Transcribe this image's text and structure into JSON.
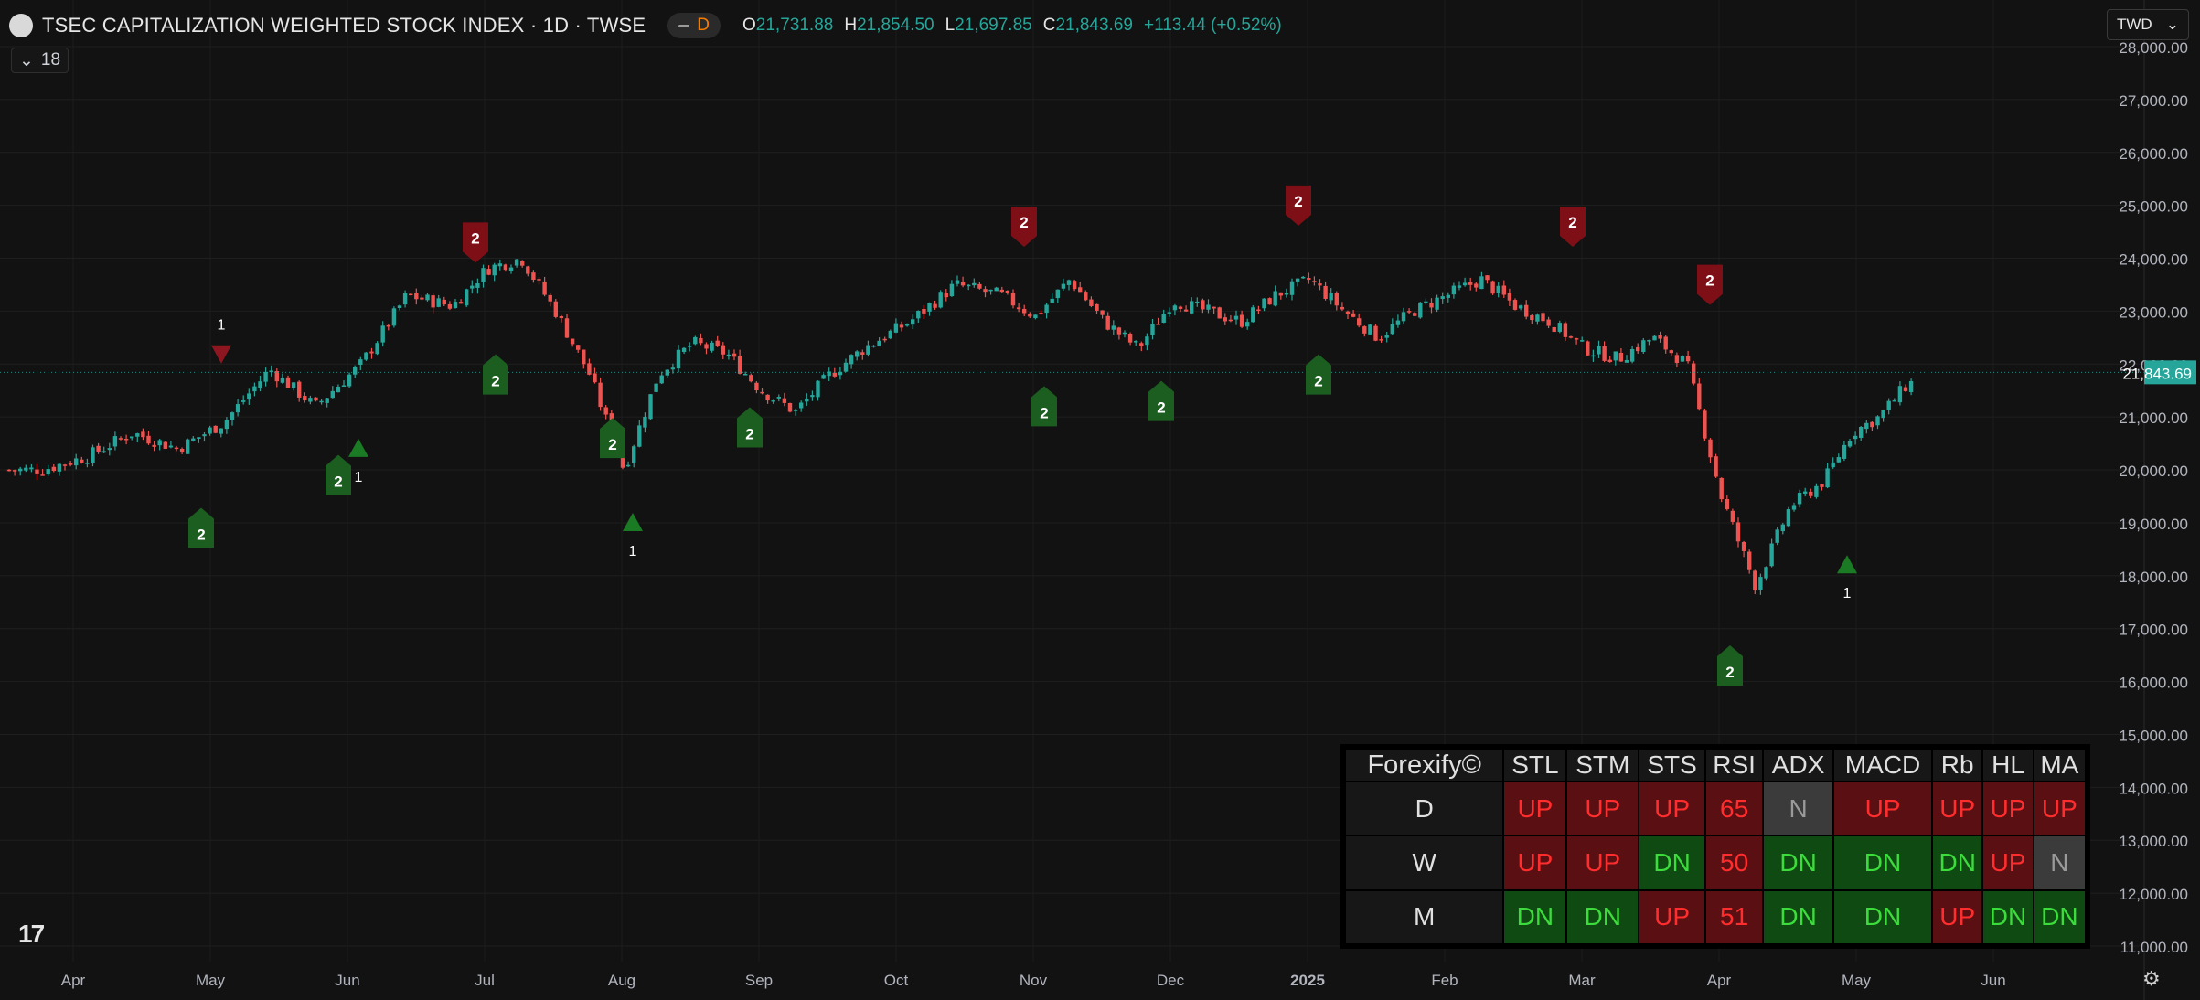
{
  "header": {
    "symbol_title": "TSEC CAPITALIZATION WEIGHTED STOCK INDEX · 1D · TWSE",
    "interval_badge": "D",
    "open_label": "O",
    "open_value": "21,731.88",
    "high_label": "H",
    "high_value": "21,854.50",
    "low_label": "L",
    "low_value": "21,697.85",
    "close_label": "C",
    "close_value": "21,843.69",
    "change": "+113.44 (+0.52%)",
    "indicator_count": "18",
    "currency": "TWD"
  },
  "colors": {
    "up": "#26a69a",
    "down": "#ef5350",
    "buy_marker": "#1b5e20",
    "sell_marker": "#7f0f17",
    "price_label_bg": "#26a69a"
  },
  "chart_data": {
    "type": "candlestick",
    "price_axis": {
      "ticks": [
        "11,000.00",
        "12,000.00",
        "13,000.00",
        "14,000.00",
        "15,000.00",
        "16,000.00",
        "17,000.00",
        "18,000.00",
        "19,000.00",
        "20,000.00",
        "21,000.00",
        "22,000.00",
        "23,000.00",
        "24,000.00",
        "25,000.00",
        "26,000.00",
        "27,000.00",
        "28,000.00"
      ],
      "ylim": [
        10700,
        28700
      ]
    },
    "time_axis": {
      "labels": [
        "Apr",
        "May",
        "Jun",
        "Jul",
        "Aug",
        "Sep",
        "Oct",
        "Nov",
        "Dec",
        "2025",
        "Feb",
        "Mar",
        "Apr",
        "May",
        "Jun"
      ]
    },
    "last_price": 21843.69,
    "last_price_label": "21,843.69",
    "series": [
      {
        "name": "Apr",
        "values": [
          20000,
          20250,
          20700
        ]
      },
      {
        "name": "May",
        "values": [
          20400,
          20900,
          21900
        ]
      },
      {
        "name": "Jun",
        "values": [
          21200,
          22000,
          23300
        ]
      },
      {
        "name": "Jul",
        "values": [
          23100,
          23800,
          24000,
          23000
        ]
      },
      {
        "name": "Aug",
        "values": [
          21800,
          20000,
          21800,
          22400
        ]
      },
      {
        "name": "Sep",
        "values": [
          22200,
          21500,
          21100,
          21800
        ]
      },
      {
        "name": "Oct",
        "values": [
          22300,
          22800,
          23500
        ]
      },
      {
        "name": "Nov",
        "values": [
          23300,
          22900,
          23600,
          22800
        ]
      },
      {
        "name": "Dec",
        "values": [
          22300,
          23200,
          23000,
          22800
        ]
      },
      {
        "name": "2025",
        "values": [
          23300,
          23600,
          23000,
          22500
        ]
      },
      {
        "name": "Feb",
        "values": [
          23000,
          23300,
          23600,
          23100
        ]
      },
      {
        "name": "Mar",
        "values": [
          22800,
          22300,
          22100,
          22500
        ]
      },
      {
        "name": "Apr",
        "values": [
          22000,
          19500,
          17800,
          19300
        ]
      },
      {
        "name": "May",
        "values": [
          19800,
          20700,
          21000,
          21600,
          21844
        ]
      }
    ],
    "signal_markers": [
      {
        "t": "May",
        "dir": "buy",
        "level": "2",
        "price": 18800
      },
      {
        "t": "May",
        "dir": "sell",
        "level": "1",
        "price": 22200
      },
      {
        "t": "Jun",
        "dir": "buy",
        "level": "2",
        "price": 19800
      },
      {
        "t": "Jun",
        "dir": "buy",
        "level": "1",
        "price": 20400
      },
      {
        "t": "Jul",
        "dir": "sell",
        "level": "2",
        "price": 24400
      },
      {
        "t": "Jul",
        "dir": "buy",
        "level": "2",
        "price": 21700
      },
      {
        "t": "Aug",
        "dir": "buy",
        "level": "2",
        "price": 20500
      },
      {
        "t": "Aug",
        "dir": "buy",
        "level": "1",
        "price": 19000
      },
      {
        "t": "Sep",
        "dir": "buy",
        "level": "2",
        "price": 20700
      },
      {
        "t": "Nov",
        "dir": "sell",
        "level": "2",
        "price": 24700
      },
      {
        "t": "Nov",
        "dir": "buy",
        "level": "2",
        "price": 21100
      },
      {
        "t": "Dec",
        "dir": "buy",
        "level": "2",
        "price": 21200
      },
      {
        "t": "2025",
        "dir": "sell",
        "level": "2",
        "price": 25100
      },
      {
        "t": "2025",
        "dir": "buy",
        "level": "2",
        "price": 21700
      },
      {
        "t": "Mar",
        "dir": "sell",
        "level": "2",
        "price": 24700
      },
      {
        "t": "Apr",
        "dir": "sell",
        "level": "2",
        "price": 23600
      },
      {
        "t": "Apr",
        "dir": "buy",
        "level": "2",
        "price": 16200
      },
      {
        "t": "May",
        "dir": "buy",
        "level": "1",
        "price": 18200
      }
    ]
  },
  "dashboard": {
    "brand": "Forexify©",
    "columns": [
      "STL",
      "STM",
      "STS",
      "RSI",
      "ADX",
      "MACD",
      "Rb",
      "HL",
      "MA"
    ],
    "rows": [
      {
        "label": "D",
        "cells": [
          {
            "text": "UP",
            "state": "up"
          },
          {
            "text": "UP",
            "state": "up"
          },
          {
            "text": "UP",
            "state": "up"
          },
          {
            "text": "65",
            "state": "up"
          },
          {
            "text": "N",
            "state": "n"
          },
          {
            "text": "UP",
            "state": "up"
          },
          {
            "text": "UP",
            "state": "up"
          },
          {
            "text": "UP",
            "state": "up"
          },
          {
            "text": "UP",
            "state": "up"
          }
        ]
      },
      {
        "label": "W",
        "cells": [
          {
            "text": "UP",
            "state": "up"
          },
          {
            "text": "UP",
            "state": "up"
          },
          {
            "text": "DN",
            "state": "dn"
          },
          {
            "text": "50",
            "state": "up"
          },
          {
            "text": "DN",
            "state": "dn"
          },
          {
            "text": "DN",
            "state": "dn"
          },
          {
            "text": "DN",
            "state": "dn"
          },
          {
            "text": "UP",
            "state": "up"
          },
          {
            "text": "N",
            "state": "n"
          }
        ]
      },
      {
        "label": "M",
        "cells": [
          {
            "text": "DN",
            "state": "dn"
          },
          {
            "text": "DN",
            "state": "dn"
          },
          {
            "text": "UP",
            "state": "up"
          },
          {
            "text": "51",
            "state": "up"
          },
          {
            "text": "DN",
            "state": "dn"
          },
          {
            "text": "DN",
            "state": "dn"
          },
          {
            "text": "UP",
            "state": "up"
          },
          {
            "text": "DN",
            "state": "dn"
          },
          {
            "text": "DN",
            "state": "dn"
          }
        ]
      }
    ]
  }
}
